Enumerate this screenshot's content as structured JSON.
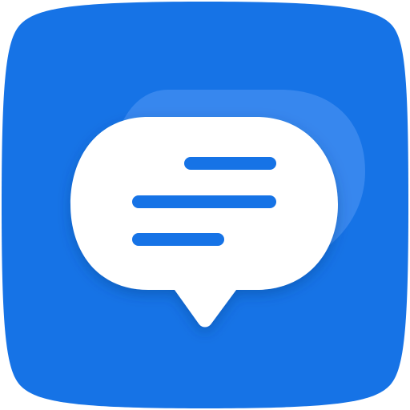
{
  "app_icon": {
    "icon": "message-bubble-icon",
    "colors": {
      "tile": "#1673E6",
      "back_bubble": "#3D8BEE",
      "front_bubble": "#FFFFFF",
      "text_lines": "#1673E6"
    }
  }
}
